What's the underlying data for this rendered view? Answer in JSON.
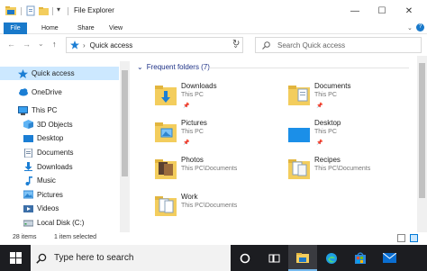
{
  "window": {
    "title": "File Explorer",
    "controls": {
      "minimize": "—",
      "maximize": "☐",
      "close": "✕"
    }
  },
  "ribbon": {
    "tabs": [
      "File",
      "Home",
      "Share",
      "View"
    ],
    "expand_glyph": "⌄",
    "help_glyph": "?"
  },
  "address": {
    "back": "←",
    "forward": "→",
    "recent": "⌄",
    "up": "↑",
    "crumb_sep": "›",
    "location": "Quick access",
    "dropdown": "⌄",
    "refresh": "↻",
    "search_placeholder": "Search Quick access"
  },
  "sidebar": {
    "items": [
      {
        "label": "Quick access",
        "icon": "star-icon",
        "level": 0,
        "selected": true
      },
      {
        "label": "OneDrive",
        "icon": "cloud-icon",
        "level": 0,
        "selected": false
      },
      {
        "label": "This PC",
        "icon": "pc-icon",
        "level": 0,
        "selected": false
      },
      {
        "label": "3D Objects",
        "icon": "cube-icon",
        "level": 1,
        "selected": false
      },
      {
        "label": "Desktop",
        "icon": "desktop-icon",
        "level": 1,
        "selected": false
      },
      {
        "label": "Documents",
        "icon": "document-icon",
        "level": 1,
        "selected": false
      },
      {
        "label": "Downloads",
        "icon": "download-icon",
        "level": 1,
        "selected": false
      },
      {
        "label": "Music",
        "icon": "music-icon",
        "level": 1,
        "selected": false
      },
      {
        "label": "Pictures",
        "icon": "picture-icon",
        "level": 1,
        "selected": false
      },
      {
        "label": "Videos",
        "icon": "video-icon",
        "level": 1,
        "selected": false
      },
      {
        "label": "Local Disk (C:)",
        "icon": "disk-icon",
        "level": 1,
        "selected": false
      }
    ]
  },
  "main": {
    "group_title": "Frequent folders (7)",
    "group_toggle": "⌄",
    "folders": [
      {
        "name": "Downloads",
        "location": "This PC",
        "pinned": true,
        "icon": "downloads-folder-icon"
      },
      {
        "name": "Documents",
        "location": "This PC",
        "pinned": true,
        "icon": "documents-folder-icon"
      },
      {
        "name": "Pictures",
        "location": "This PC",
        "pinned": true,
        "icon": "pictures-folder-icon"
      },
      {
        "name": "Desktop",
        "location": "This PC",
        "pinned": true,
        "icon": "desktop-folder-icon"
      },
      {
        "name": "Photos",
        "location": "This PC\\Documents",
        "pinned": false,
        "icon": "photos-folder-icon"
      },
      {
        "name": "Recipes",
        "location": "This PC\\Documents",
        "pinned": false,
        "icon": "recipes-folder-icon"
      },
      {
        "name": "Work",
        "location": "This PC\\Documents",
        "pinned": false,
        "icon": "work-folder-icon"
      }
    ],
    "pin_glyph": "📌"
  },
  "status": {
    "item_count": "28 items",
    "selection": "1 item selected"
  },
  "taskbar": {
    "search_placeholder": "Type here to search",
    "accent": "#76b9ed"
  },
  "colors": {
    "accent": "#0078d7",
    "file_tab": "#1979ca",
    "selection": "#cce8ff",
    "group_heading": "#1e3287",
    "folder": "#f3cd5d"
  }
}
